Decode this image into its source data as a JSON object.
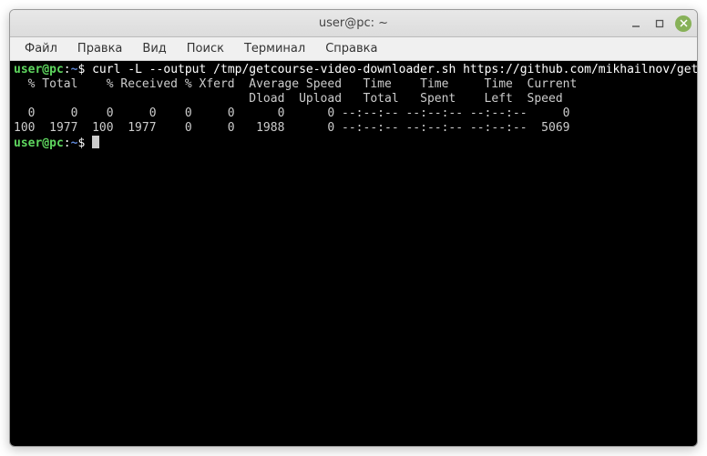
{
  "titlebar": {
    "title": "user@pc: ~"
  },
  "menubar": {
    "items": [
      "Файл",
      "Правка",
      "Вид",
      "Поиск",
      "Терминал",
      "Справка"
    ]
  },
  "terminal": {
    "prompt_user": "user@pc",
    "prompt_sep1": ":",
    "prompt_path": "~",
    "prompt_sep2": "$",
    "command": "curl -L --output /tmp/getcourse-video-downloader.sh https://github.com/mikhailnov/getcourse-video-downloader/raw/master/getcourse-video-downloader.sh",
    "output_header1": "  % Total    % Received % Xferd  Average Speed   Time    Time     Time  Current",
    "output_header2": "                                 Dload  Upload   Total   Spent    Left  Speed",
    "output_row1": "  0     0    0     0    0     0      0      0 --:--:-- --:--:-- --:--:--     0",
    "output_row2": "100  1977  100  1977    0     0   1988      0 --:--:-- --:--:-- --:--:--  5069",
    "prompt2_user": "user@pc",
    "prompt2_sep1": ":",
    "prompt2_path": "~",
    "prompt2_sep2": "$"
  }
}
